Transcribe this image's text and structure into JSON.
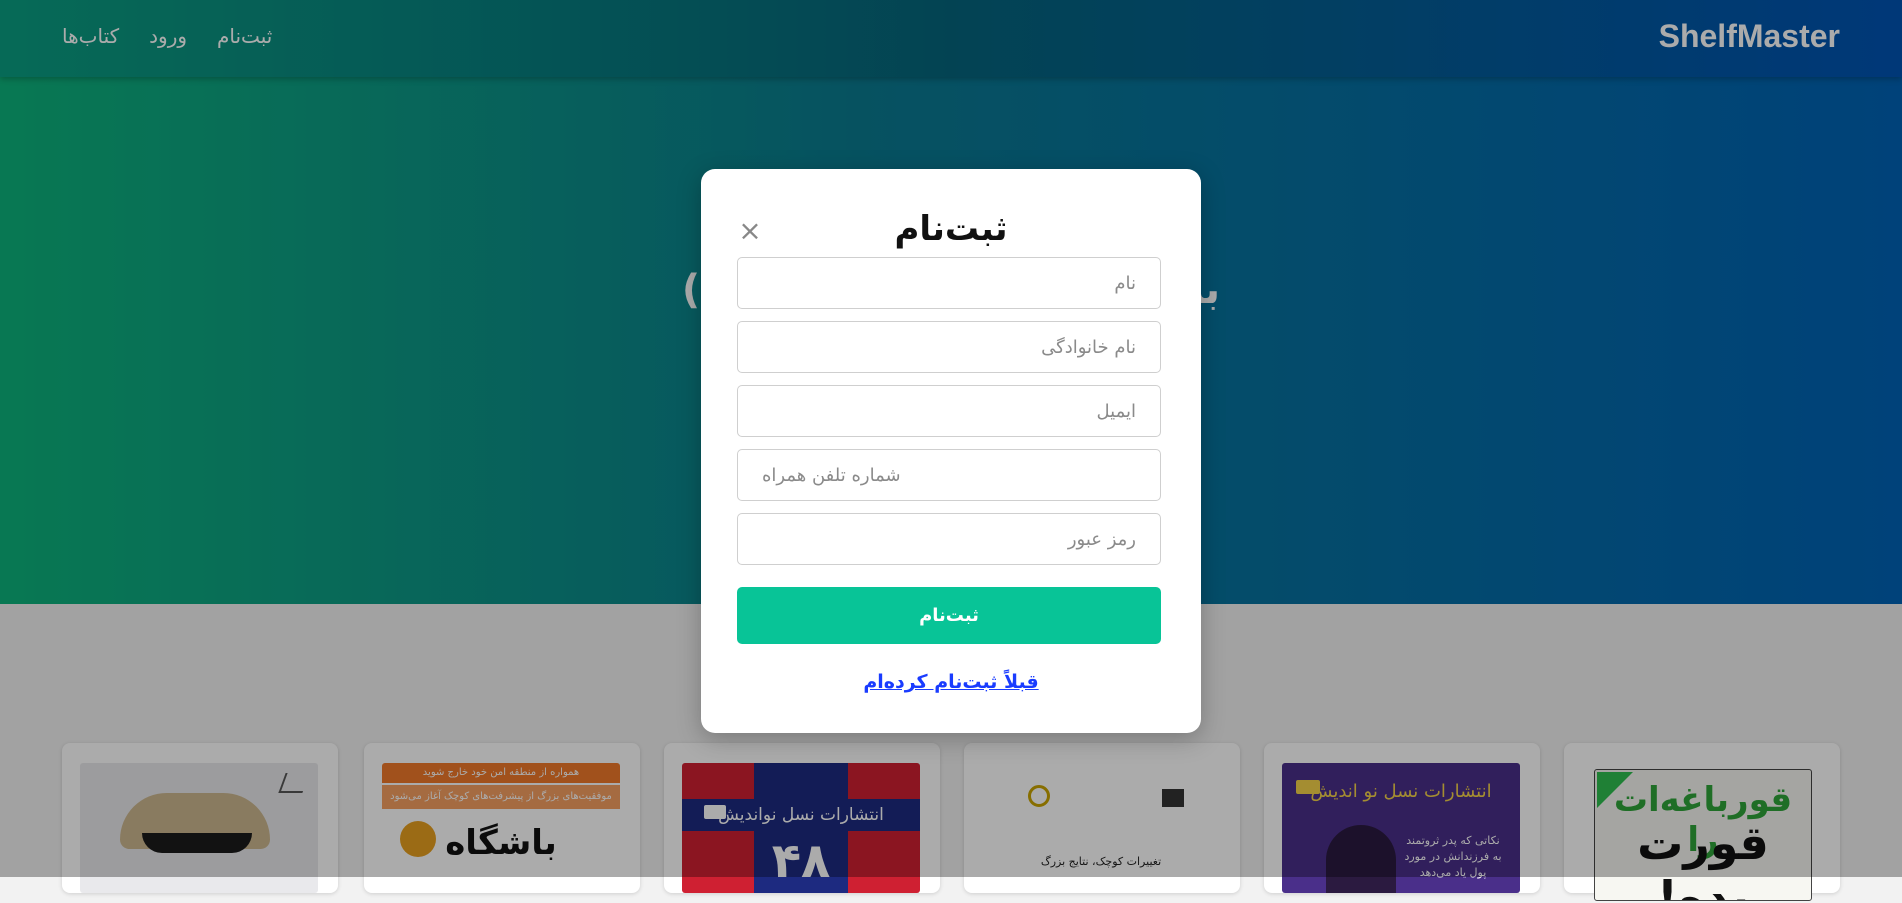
{
  "header": {
    "brand": "ShelfMaster",
    "nav": [
      {
        "label": "کتاب‌ها"
      },
      {
        "label": "ورود"
      },
      {
        "label": "ثبت‌نام"
      }
    ]
  },
  "hero": {
    "title_left": "دی :)",
    "title_right": "به کت"
  },
  "modal": {
    "title": "ثبت‌نام",
    "close_symbol": "×",
    "fields": {
      "first_name": "نام",
      "last_name": "نام خانوادگی",
      "email": "ایمیل",
      "phone": "شماره تلفن همراه",
      "password": "رمز عبور"
    },
    "submit_label": "ثبت‌نام",
    "login_link": "قبلاً ثبت‌نام کرده‌ام"
  },
  "books": [
    {
      "cover_text": ""
    },
    {
      "cover_text_top": "همواره از منطقه امن خود خارج شوید",
      "cover_text_mid": "موفقیت‌های بزرگ از پیشرفت‌های کوچک آغاز می‌شود",
      "cover_text_big": "باشگاه"
    },
    {
      "cover_text_top": "انتشارات نسل نواندیش",
      "cover_number": "۴۸"
    },
    {
      "cover_text_mid": "تغییرات کوچک، نتایج بزرگ"
    },
    {
      "cover_text_top": "انتشارات نسل نو اندیش",
      "cover_text_mid": "نکاتی که پدر ثروتمند به فرزندانش در مورد پول یاد می‌دهد"
    },
    {
      "cover_text_big_1": "قورباغه‌ات را",
      "cover_text_big_2": "قورت بده!"
    }
  ],
  "colors": {
    "accent": "#08c497",
    "link": "#1a3cff",
    "nav_gradient": [
      "#0a9f82",
      "#0054b4"
    ]
  }
}
